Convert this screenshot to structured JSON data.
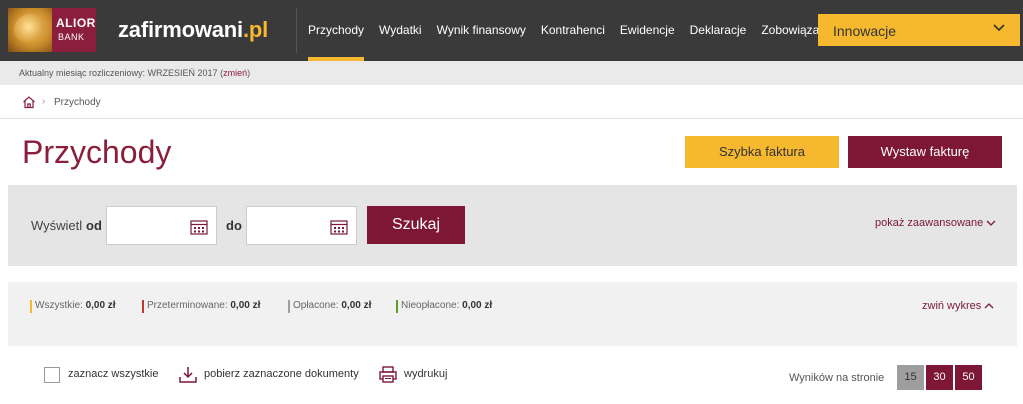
{
  "header": {
    "logo_line1": "ALIOR",
    "logo_line2": "BANK",
    "site_name_main": "zafirmowani",
    "site_name_tld": ".pl",
    "nav": [
      "Przychody",
      "Wydatki",
      "Wynik finansowy",
      "Kontrahenci",
      "Ewidencje",
      "Deklaracje",
      "Zobowiązania"
    ],
    "active_nav": "Przychody",
    "innovations_label": "Innowacje"
  },
  "month_bar": {
    "text": "Aktualny miesiąc rozliczeniowy: WRZESIEŃ 2017 (",
    "change_link": "zmień",
    "close_paren": ")"
  },
  "breadcrumb": {
    "current": "Przychody"
  },
  "page": {
    "title": "Przychody",
    "quick_invoice_label": "Szybka faktura",
    "issue_invoice_label": "Wystaw fakturę"
  },
  "filter": {
    "show_label": "Wyświetl",
    "from_label": "od",
    "to_label": "do",
    "from_value": "",
    "to_value": "",
    "search_label": "Szukaj",
    "advanced_label": "pokaż zaawansowane"
  },
  "summary": {
    "items": [
      {
        "label": "Wszystkie:",
        "value": "0,00 zł",
        "color": "#f5b82e"
      },
      {
        "label": "Przeterminowane:",
        "value": "0,00 zł",
        "color": "#c0392b"
      },
      {
        "label": "Opłacone:",
        "value": "0,00 zł",
        "color": "#9e9e9e"
      },
      {
        "label": "Nieopłacone:",
        "value": "0,00 zł",
        "color": "#5aa02c"
      }
    ],
    "collapse_label": "zwiń wykres"
  },
  "toolbar": {
    "select_all_label": "zaznacz wszystkie",
    "download_label": "pobierz zaznaczone dokumenty",
    "print_label": "wydrukuj",
    "per_page_label": "Wyników na stronie",
    "per_page_options": [
      "15",
      "30",
      "50"
    ],
    "per_page_selected": "15"
  },
  "colors": {
    "brand": "#7d1735",
    "accent": "#f5b82e",
    "header_bg": "#3a3a3a"
  }
}
